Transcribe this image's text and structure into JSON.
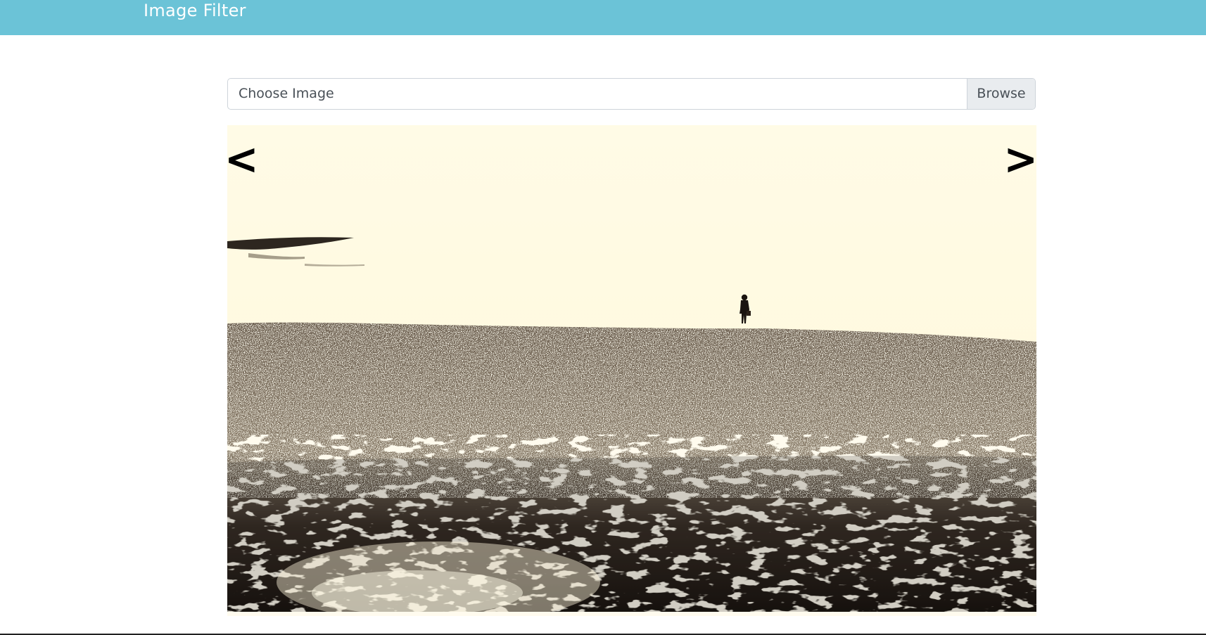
{
  "navbar": {
    "brand": "Image Filter",
    "color": "#6bc3d7"
  },
  "upload": {
    "label": "Choose Image",
    "browse_label": "Browse"
  },
  "viewer": {
    "prev_label": "<",
    "next_label": ">",
    "image_icon": "filtered-photo"
  }
}
